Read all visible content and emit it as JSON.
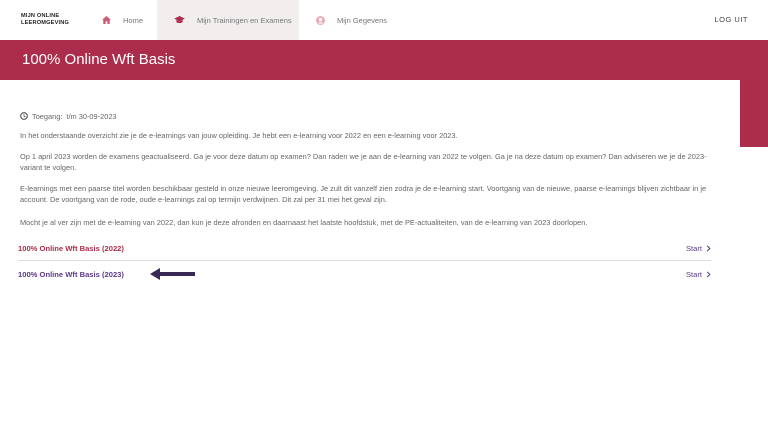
{
  "nav": {
    "logo_line1": "MIJN ONLINE",
    "logo_line2": "LEEROMGEVING",
    "home": "Home",
    "trainings": "Mijn Trainingen en Examens",
    "data": "Mijn Gegevens",
    "logout": "LOG UIT"
  },
  "page": {
    "title": "100% Online Wft Basis",
    "access_label": "Toegang:",
    "access_value": "t/m 30-09-2023",
    "p1": "In het onderstaande overzicht zie je de e-learnings van jouw opleiding. Je hebt een e-learning voor 2022 en een e-learning voor 2023.",
    "p2": "Op 1 april 2023 worden de examens geactualiseerd. Ga je voor deze datum op examen? Dan raden we je aan de e-learning van 2022 te volgen. Ga je na deze datum op examen? Dan adviseren we je de 2023-variant te volgen.",
    "p3": "E-learnings met een paarse titel worden beschikbaar gesteld in onze nieuwe leeromgeving. Je zult dit vanzelf zien zodra je de e-learning start. Voortgang van de nieuwe, paarse e-learnings blijven zichtbaar in je account. De voortgang van de rode, oude e-learnings zal op termijn verdwijnen. Dit zal per 31 mei het geval zijn.",
    "p4": "Mocht je al ver zijn met de e-learning van 2022, dan kun je deze afronden en daarnaast het laatste hoofdstuk, met de PE-actualiteiten, van de e-learning van 2023 doorlopen."
  },
  "courses": [
    {
      "name": "100% Online Wft Basis (2022)",
      "action": "Start"
    },
    {
      "name": "100% Online Wft Basis (2023)",
      "action": "Start"
    }
  ],
  "colors": {
    "brand": "#ac2d4b",
    "purple": "#5b3a86"
  }
}
